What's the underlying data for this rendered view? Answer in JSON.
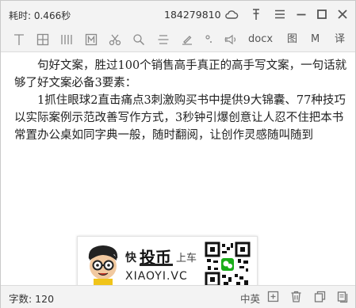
{
  "titlebar": {
    "elapsed_label": "耗时: 0.466秒",
    "doc_id": "184279810",
    "icons": [
      "cloud-icon",
      "pin-icon",
      "menu-icon",
      "minimize-icon",
      "maximize-icon",
      "close-icon"
    ]
  },
  "toolbar": {
    "tools": [
      "text-cursor-icon",
      "table-icon",
      "columns-icon",
      "merge-icon",
      "cut-icon",
      "search-icon",
      "align-icon",
      "edit-icon",
      "degree-icon",
      "speaker-icon"
    ],
    "docx_label": "docx",
    "image_label": "图",
    "m_label": "M",
    "translate_label": "译"
  },
  "content": {
    "paragraphs": [
      "句好文案，胜过100个销售高手真正的高手写文案，一句话就够了好文案必备3要素：",
      "1抓住眼球2直击痛点3刺激购买书中提供9大锦囊、77种技巧以实际案例示范改善写作方式，3秒钟引爆创意让人忍不住把本书常置办公桌如同字典一般，随时翻阅，让创作灵感随叫随到"
    ]
  },
  "watermark": {
    "text_fast": "快",
    "brand": "投币",
    "text_car": "上车",
    "domain": "XIAOYI.VC"
  },
  "statusbar": {
    "word_count_label": "字数: 120",
    "language_label": "中英",
    "icons": [
      "add-page-icon",
      "delete-icon",
      "copy-icon",
      "pages-icon"
    ]
  },
  "colors": {
    "chrome_bg": "#f3f3f3",
    "icon_gray": "#8a8a8a",
    "qr_green": "#1aad19"
  }
}
